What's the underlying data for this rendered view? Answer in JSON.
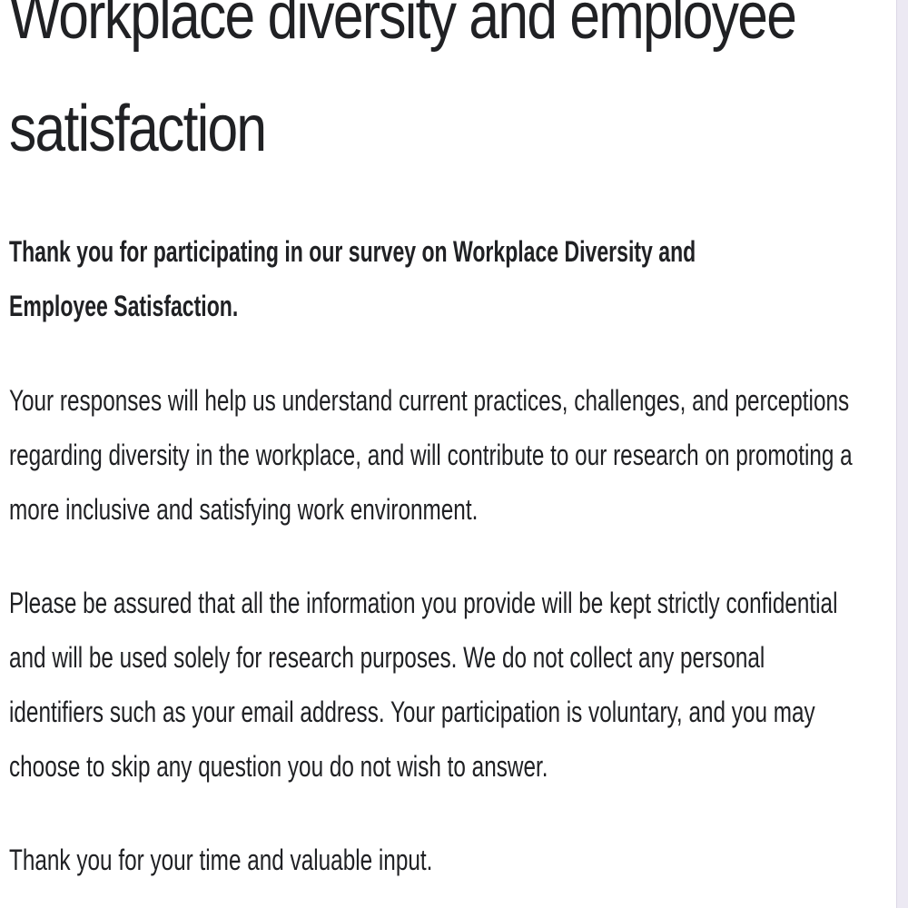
{
  "form": {
    "title": "Workplace diversity and employee satisfaction",
    "intro_bold": "Thank you for participating in our survey on Workplace Diversity and Employee Satisfaction.",
    "paragraph_purpose": "Your responses will help us understand current practices, challenges, and perceptions regarding diversity in the workplace, and will contribute to our research on promoting a more inclusive and satisfying work environment.",
    "paragraph_confidentiality": "Please be assured that all the information you provide will be kept strictly confidential and will be used solely for research purposes. We do not collect any personal identifiers such as your email address. Your participation is voluntary, and you may choose to skip any question you do not wish to answer.",
    "closing": "Thank you for your time and valuable input."
  }
}
